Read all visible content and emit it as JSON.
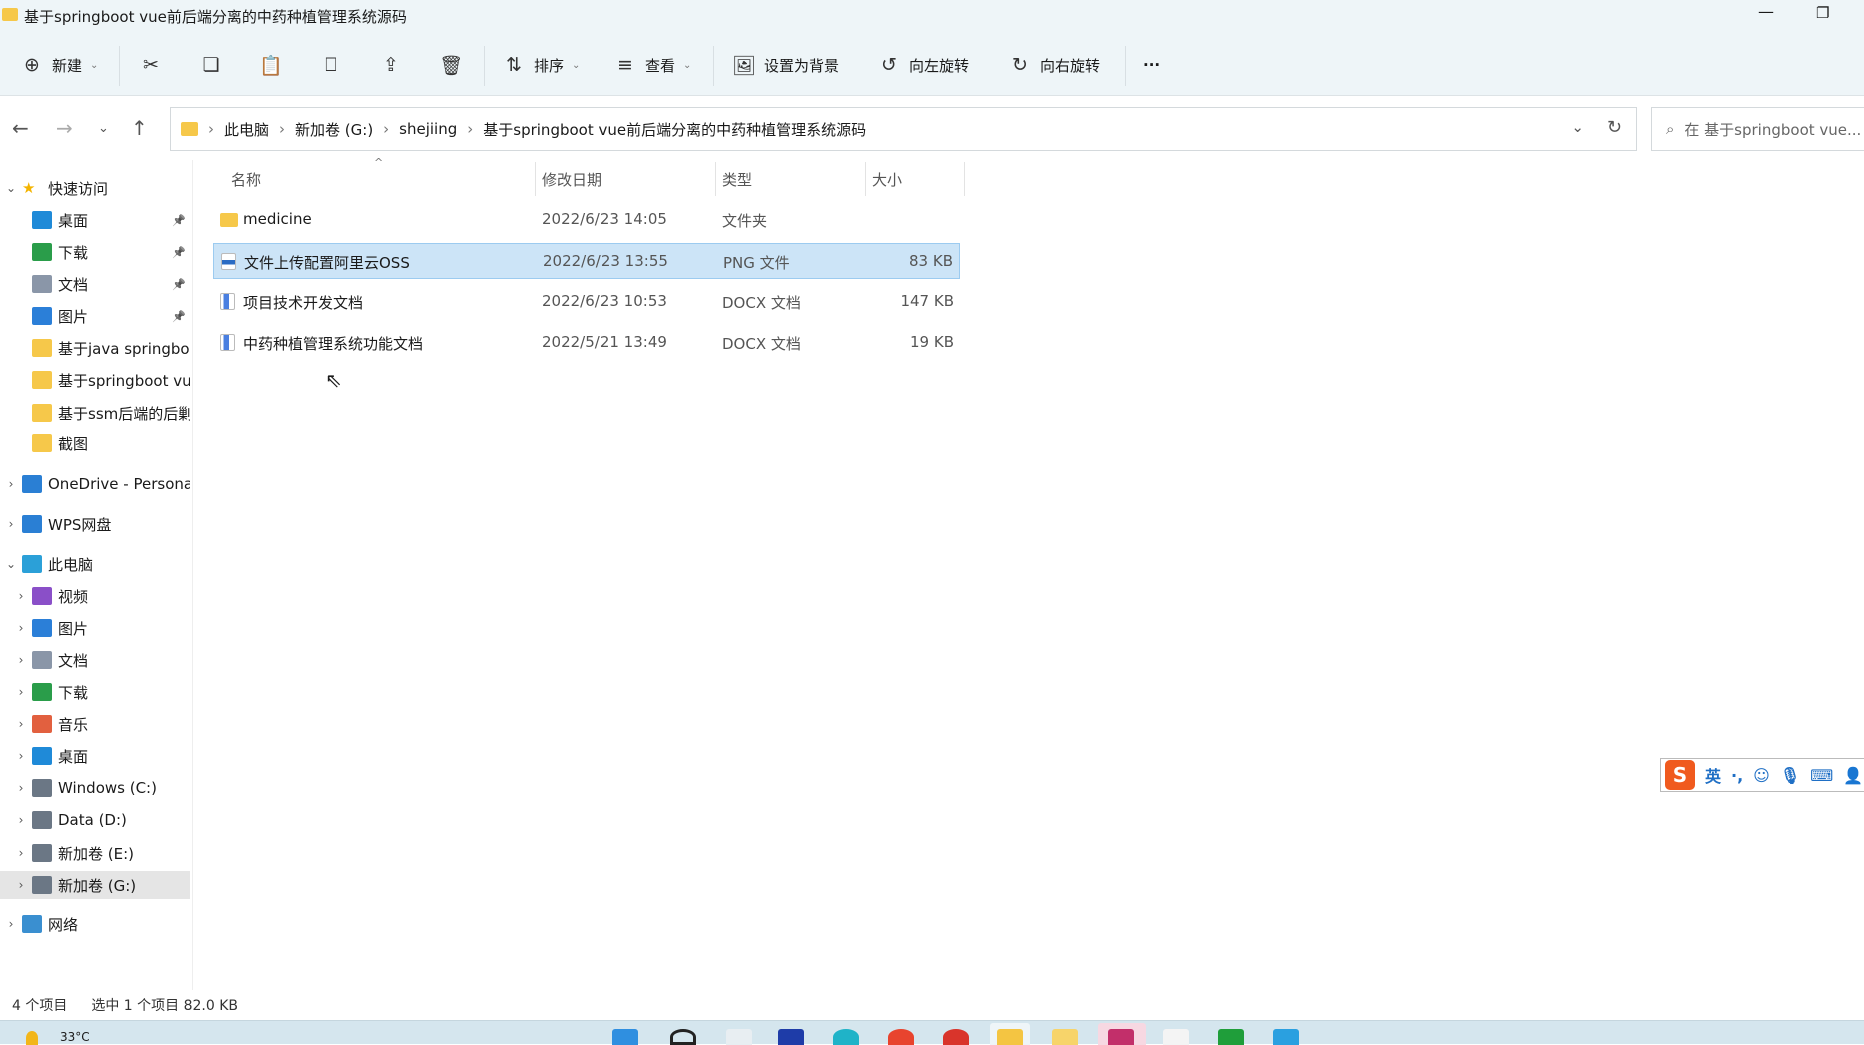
{
  "window": {
    "title": "基于springboot vue前后端分离的中药种植管理系统源码"
  },
  "toolbar": {
    "new": "新建",
    "sort": "排序",
    "view": "查看",
    "set_background": "设置为背景",
    "rotate_left": "向左旋转",
    "rotate_right": "向右旋转",
    "more": "···"
  },
  "address": {
    "crumbs": [
      "此电脑",
      "新加卷 (G:)",
      "shejiing",
      "基于springboot vue前后端分离的中药种植管理系统源码"
    ],
    "search_placeholder": "在 基于springboot vue..."
  },
  "sidebar": {
    "items": [
      {
        "label": "快速访问",
        "icon": "star",
        "level": 0,
        "expand": "v"
      },
      {
        "label": "桌面",
        "icon": "desktop",
        "level": 1,
        "pin": true
      },
      {
        "label": "下载",
        "icon": "download",
        "level": 1,
        "pin": true
      },
      {
        "label": "文档",
        "icon": "document",
        "level": 1,
        "pin": true
      },
      {
        "label": "图片",
        "icon": "picture",
        "level": 1,
        "pin": true
      },
      {
        "label": "基于java springbo",
        "icon": "folder",
        "level": 1
      },
      {
        "label": "基于springboot vu",
        "icon": "folder",
        "level": 1
      },
      {
        "label": "基于ssm后端的后剿",
        "icon": "folder",
        "level": 1
      },
      {
        "label": "截图",
        "icon": "folder",
        "level": 1
      },
      {
        "label": "OneDrive - Persona",
        "icon": "cloud",
        "level": 0,
        "expand": ">"
      },
      {
        "label": "WPS网盘",
        "icon": "cloud",
        "level": 0,
        "expand": ">"
      },
      {
        "label": "此电脑",
        "icon": "pc",
        "level": 0,
        "expand": "v"
      },
      {
        "label": "视频",
        "icon": "video",
        "level": 1,
        "expand": ">"
      },
      {
        "label": "图片",
        "icon": "picture",
        "level": 1,
        "expand": ">"
      },
      {
        "label": "文档",
        "icon": "document",
        "level": 1,
        "expand": ">"
      },
      {
        "label": "下载",
        "icon": "download",
        "level": 1,
        "expand": ">"
      },
      {
        "label": "音乐",
        "icon": "music",
        "level": 1,
        "expand": ">"
      },
      {
        "label": "桌面",
        "icon": "desktop",
        "level": 1,
        "expand": ">"
      },
      {
        "label": "Windows (C:)",
        "icon": "drive",
        "level": 1,
        "expand": ">"
      },
      {
        "label": "Data (D:)",
        "icon": "drive",
        "level": 1,
        "expand": ">"
      },
      {
        "label": "新加卷 (E:)",
        "icon": "drive",
        "level": 1,
        "expand": ">"
      },
      {
        "label": "新加卷 (G:)",
        "icon": "drive",
        "level": 1,
        "expand": ">",
        "selected": true
      },
      {
        "label": "网络",
        "icon": "network",
        "level": 0,
        "expand": ">"
      }
    ]
  },
  "columns": {
    "name": "名称",
    "date": "修改日期",
    "type": "类型",
    "size": "大小"
  },
  "files": [
    {
      "name": "medicine",
      "date": "2022/6/23 14:05",
      "type": "文件夹",
      "size": "",
      "icon": "folder"
    },
    {
      "name": "文件上传配置阿里云OSS",
      "date": "2022/6/23 13:55",
      "type": "PNG 文件",
      "size": "83 KB",
      "icon": "png",
      "selected": true
    },
    {
      "name": "项目技术开发文档",
      "date": "2022/6/23 10:53",
      "type": "DOCX 文档",
      "size": "147 KB",
      "icon": "docx"
    },
    {
      "name": "中药种植管理系统功能文档",
      "date": "2022/5/21 13:49",
      "type": "DOCX 文档",
      "size": "19 KB",
      "icon": "docx"
    }
  ],
  "status": {
    "count": "4 个项目",
    "selected": "选中 1 个项目 82.0 KB"
  },
  "ime": {
    "mode": "英",
    "punct": "·,"
  },
  "taskbar": {
    "weather": "33°C"
  }
}
